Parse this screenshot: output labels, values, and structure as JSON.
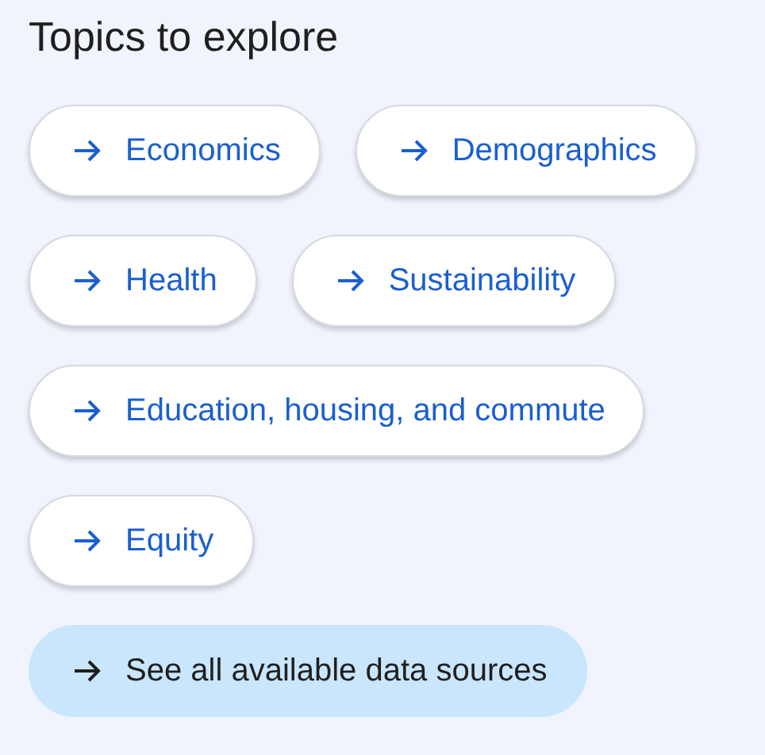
{
  "title": "Topics to explore",
  "topics": [
    {
      "label": "Economics"
    },
    {
      "label": "Demographics"
    },
    {
      "label": "Health"
    },
    {
      "label": "Sustainability"
    },
    {
      "label": "Education, housing, and commute"
    },
    {
      "label": "Equity"
    }
  ],
  "see_all": {
    "label": "See all available data sources"
  }
}
